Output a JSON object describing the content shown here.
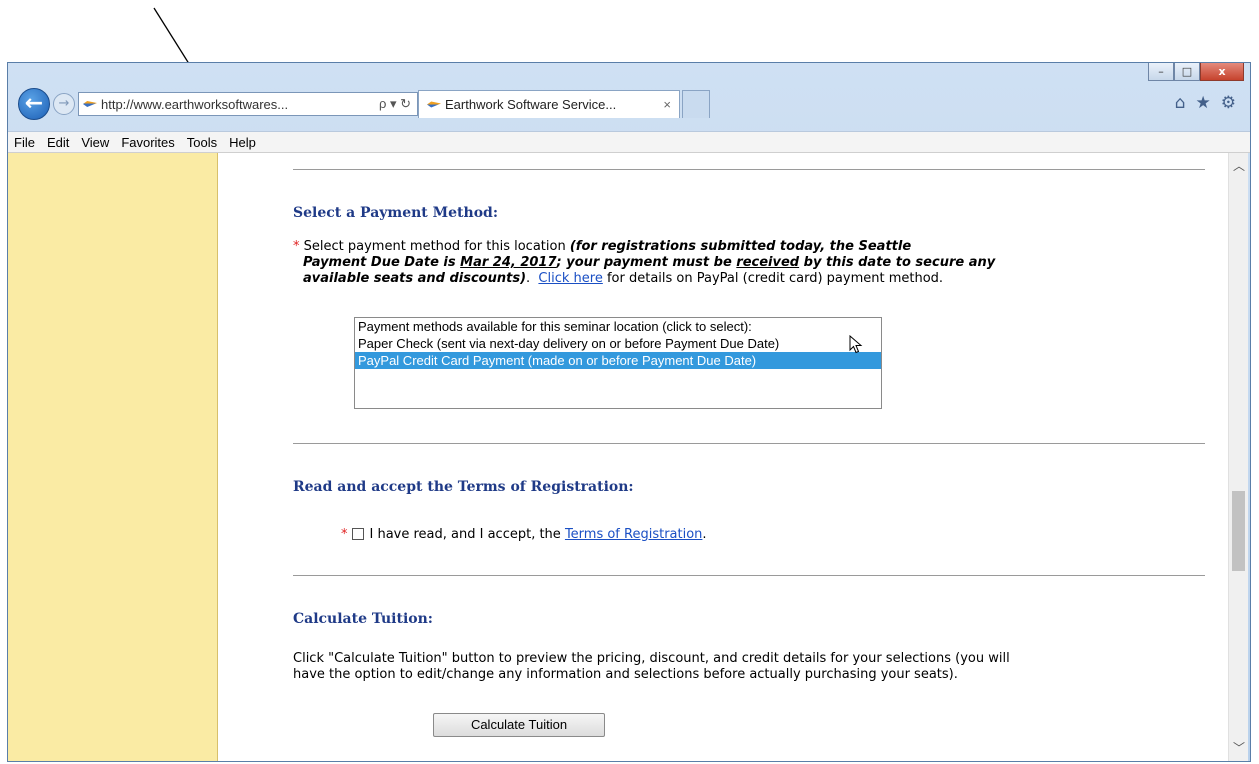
{
  "browser": {
    "address_url": "http://www.earthworksoftwares...",
    "address_tools": "ρ ▾ ↻",
    "tab_title": "Earthwork Software Service...",
    "tab_close": "×",
    "back_glyph": "←",
    "forward_glyph": "→",
    "window_controls": {
      "minimize": "–",
      "maximize": "□",
      "close": "x"
    },
    "right_icons": [
      "home-icon",
      "star-icon",
      "gear-icon"
    ],
    "home_glyph": "⌂",
    "star_glyph": "★",
    "gear_glyph": "⚙"
  },
  "menubar": {
    "items": [
      "File",
      "Edit",
      "View",
      "Favorites",
      "Tools",
      "Help"
    ]
  },
  "payment": {
    "heading": "Select a Payment Method:",
    "required_marker": "*",
    "line1_prefix": "Select payment method for this location ",
    "line1_bold": "(for registrations submitted today, the Seattle",
    "line2_bold_a": "Payment Due Date is ",
    "line2_date": "Mar 24, 2017",
    "line2_bold_b": ";  your payment must be ",
    "line2_received": "received",
    "line2_bold_c": " by this date to secure any",
    "line3_bold": "available seats and discounts)",
    "line3_after": ".  ",
    "line3_link": "Click here",
    "line3_rest": " for details on PayPal (credit card) payment method.",
    "options": [
      "Payment methods available for this seminar location (click to select):",
      "Paper Check (sent via next-day delivery on or before Payment Due Date)",
      "PayPal Credit Card Payment (made on or before Payment Due Date)"
    ],
    "selected_index": 2
  },
  "terms": {
    "heading": "Read and accept the Terms of Registration:",
    "required_marker": "*",
    "text_before": "I have read, and I accept, the ",
    "link": "Terms of Registration",
    "text_after": ".",
    "checked": false
  },
  "tuition": {
    "heading": "Calculate Tuition:",
    "line1": "Click \"Calculate Tuition\" button to preview the pricing, discount, and credit details for your selections (you will",
    "line2": "have the option to edit/change any information and selections before actually purchasing your seats).",
    "button": "Calculate Tuition"
  },
  "colors": {
    "sidebar": "#faeba4",
    "heading": "#1f3a87",
    "link": "#1a4fc4",
    "required": "#e02020",
    "selection": "#3399dd"
  }
}
